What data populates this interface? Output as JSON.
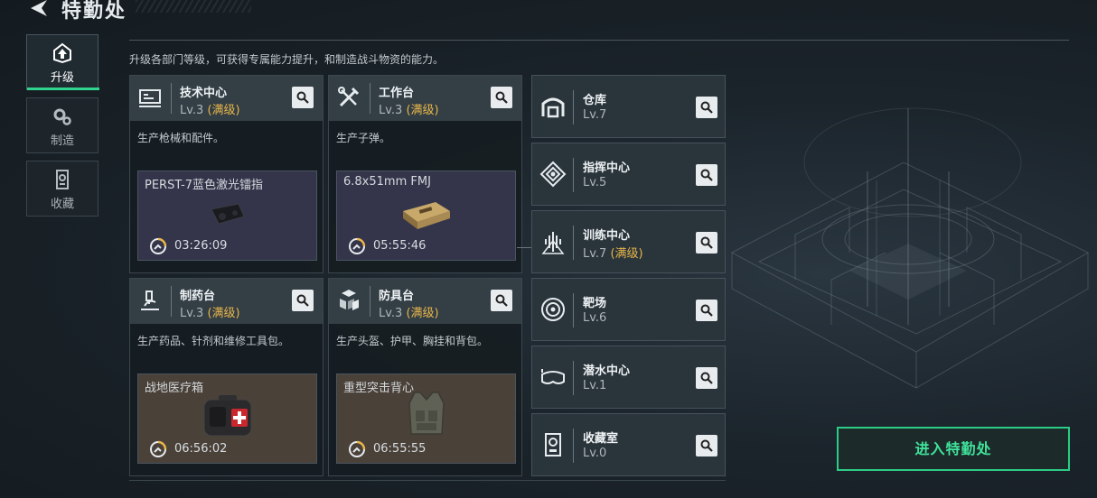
{
  "header": {
    "title": "特勤处"
  },
  "sidenav": [
    {
      "label": "升级",
      "icon": "upgrade-icon",
      "active": true
    },
    {
      "label": "制造",
      "icon": "gears-icon",
      "active": false
    },
    {
      "label": "收藏",
      "icon": "collection-icon",
      "active": false
    }
  ],
  "subtitle": "升级各部门等级，可获得专属能力提升，和制造战斗物资的能力。",
  "cards": [
    {
      "name": "技术中心",
      "level": "Lv.3",
      "max": "(满级)",
      "desc": "生产枪械和配件。",
      "craft_name": "PERST-7蓝色激光镭指",
      "craft_time": "03:26:09",
      "icon": "tech-center-icon",
      "item_icon": "laser-device-icon"
    },
    {
      "name": "工作台",
      "level": "Lv.3",
      "max": "(满级)",
      "desc": "生产子弹。",
      "craft_name": "6.8x51mm FMJ",
      "craft_time": "05:55:46",
      "icon": "tools-icon",
      "item_icon": "ammo-box-icon"
    },
    {
      "name": "制药台",
      "level": "Lv.3",
      "max": "(满级)",
      "desc": "生产药品、针剂和维修工具包。",
      "craft_name": "战地医疗箱",
      "craft_time": "06:56:02",
      "icon": "microscope-icon",
      "item_icon": "medkit-icon"
    },
    {
      "name": "防具台",
      "level": "Lv.3",
      "max": "(满级)",
      "desc": "生产头盔、护甲、胸挂和背包。",
      "craft_name": "重型突击背心",
      "craft_time": "06:55:55",
      "icon": "armor-blocks-icon",
      "item_icon": "vest-icon"
    }
  ],
  "buildings": [
    {
      "name": "仓库",
      "level": "Lv.7",
      "max": "",
      "icon": "warehouse-icon"
    },
    {
      "name": "指挥中心",
      "level": "Lv.5",
      "max": "",
      "icon": "command-icon"
    },
    {
      "name": "训练中心",
      "level": "Lv.7",
      "max": "(满级)",
      "icon": "training-icon"
    },
    {
      "name": "靶场",
      "level": "Lv.6",
      "max": "",
      "icon": "target-icon"
    },
    {
      "name": "潜水中心",
      "level": "Lv.1",
      "max": "",
      "icon": "diving-mask-icon"
    },
    {
      "name": "收藏室",
      "level": "Lv.0",
      "max": "",
      "icon": "collection-room-icon"
    }
  ],
  "enter_button": "进入特勤处",
  "colors": {
    "accent_green": "#2bcc85",
    "max_gold": "#e8b64a"
  }
}
